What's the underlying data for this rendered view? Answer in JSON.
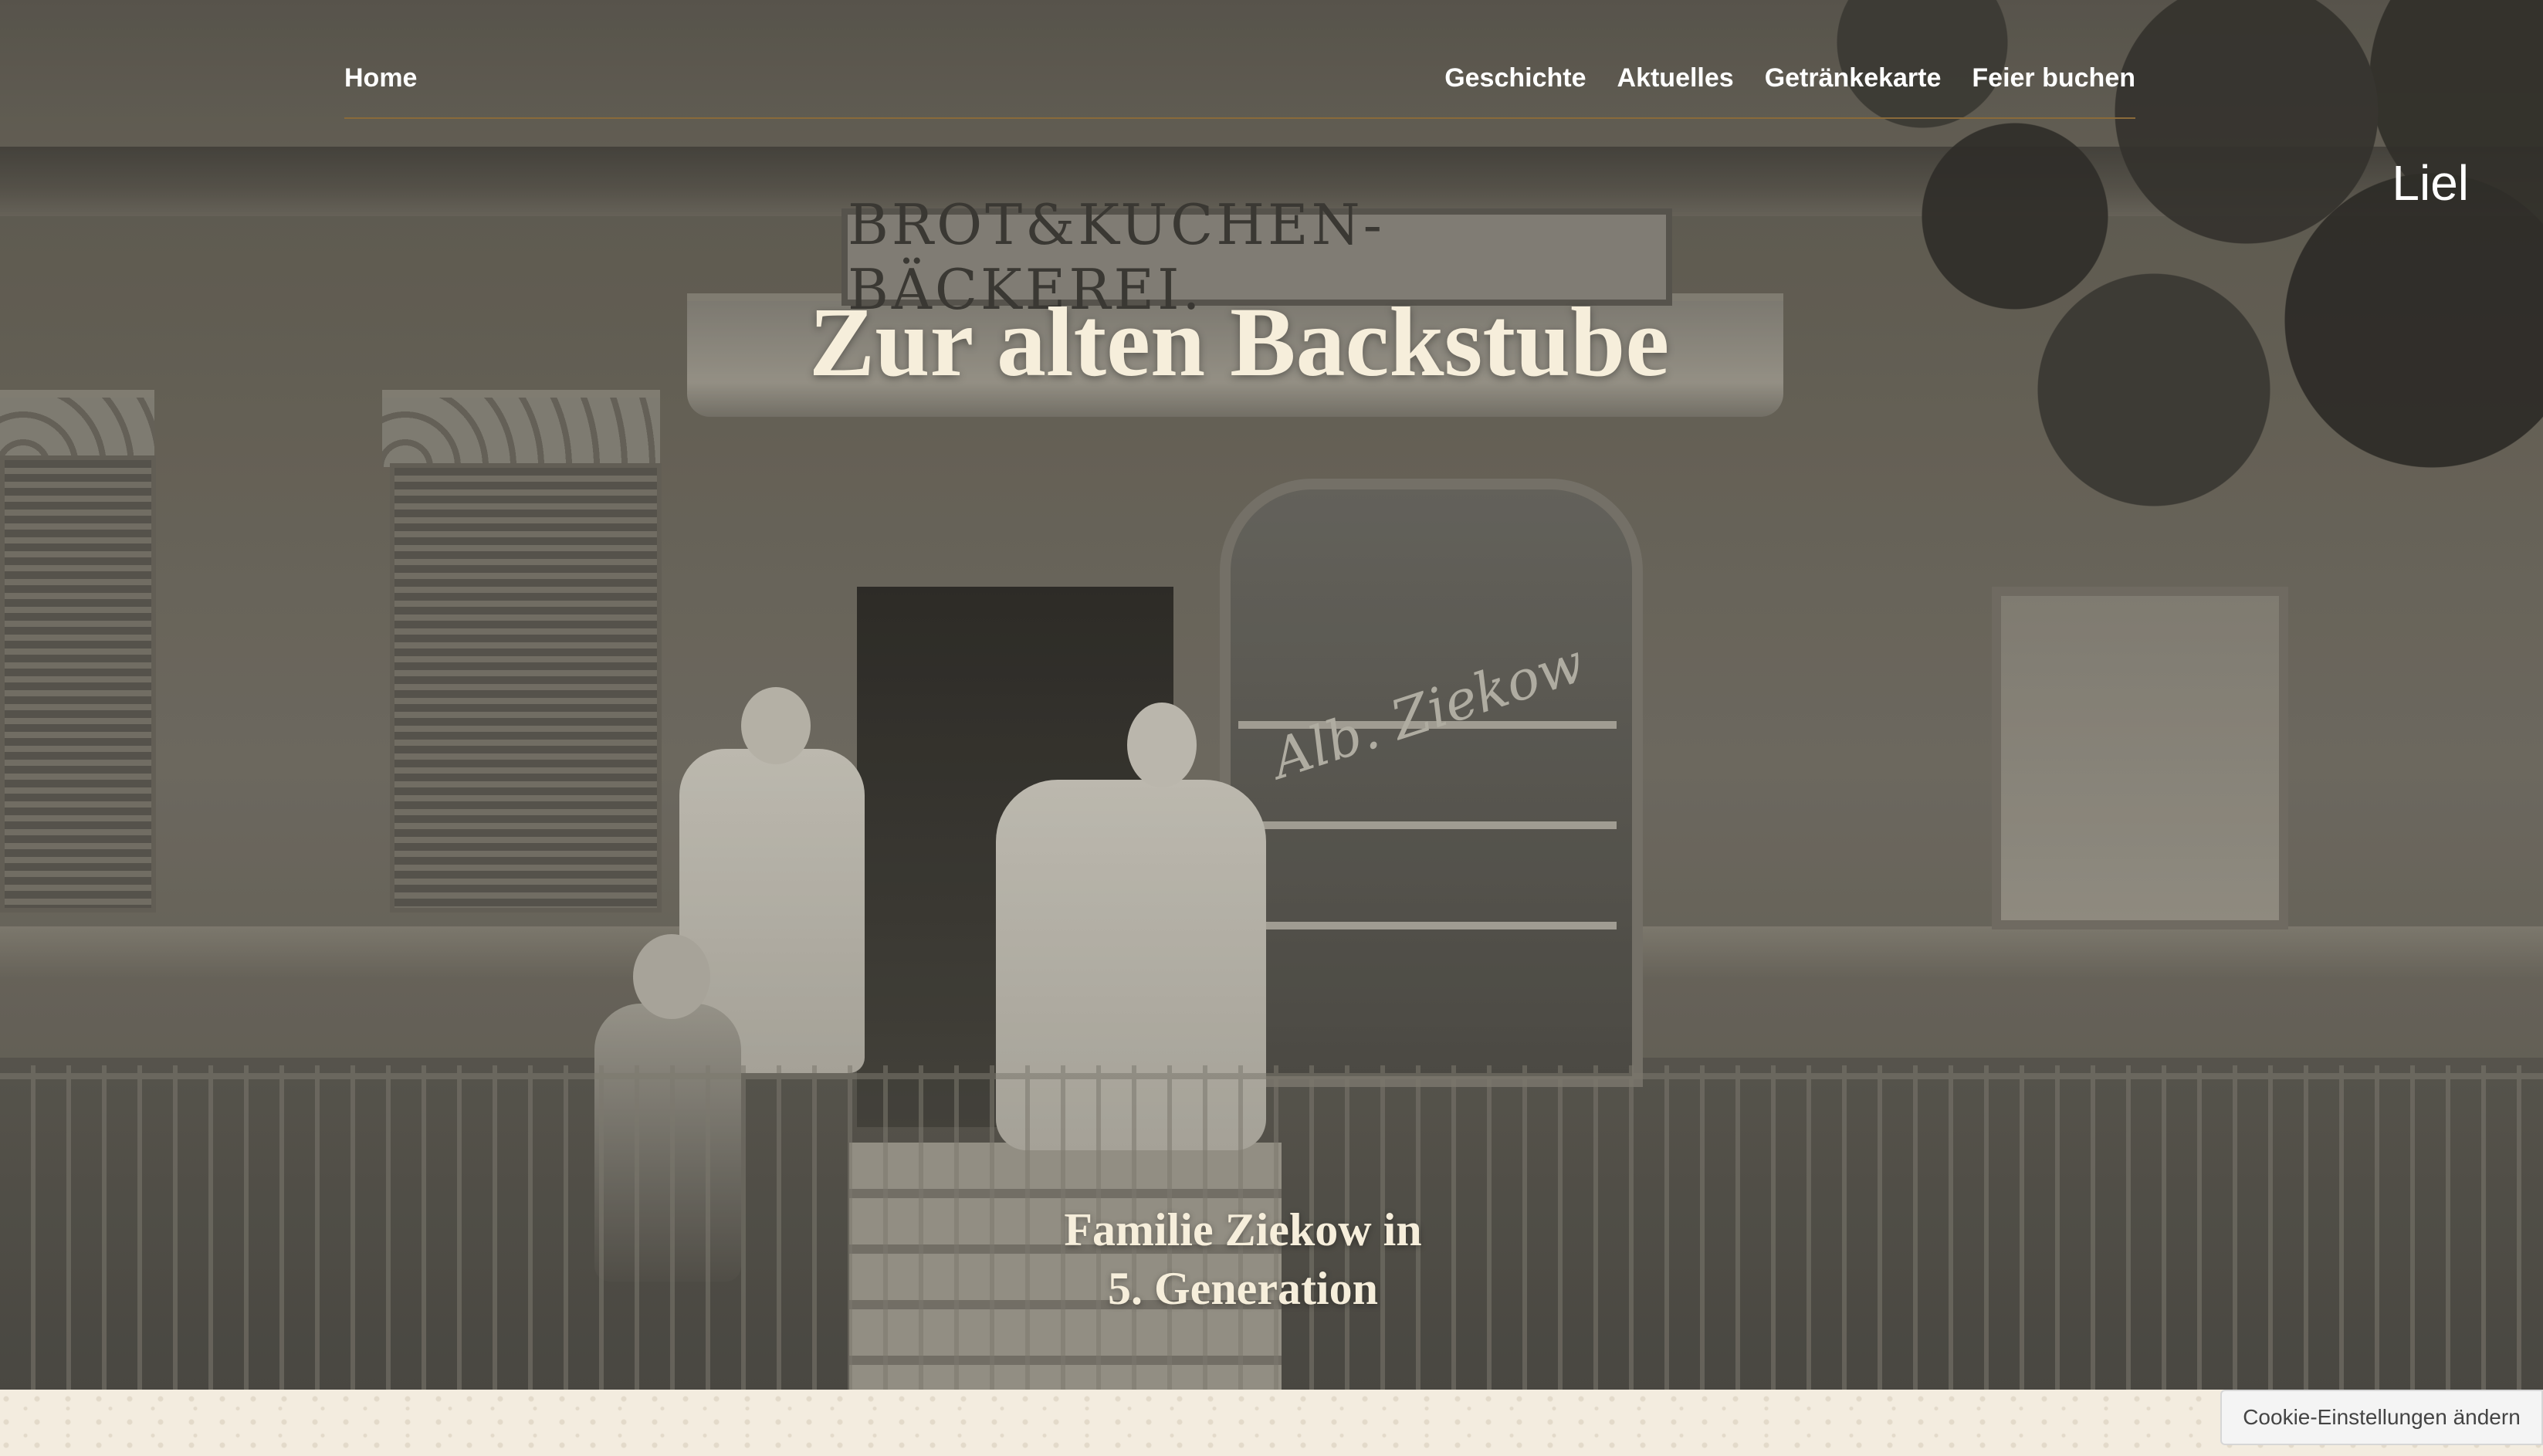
{
  "nav": {
    "home": "Home",
    "items": [
      "Geschichte",
      "Aktuelles",
      "Getränkekarte",
      "Feier buchen"
    ]
  },
  "hero": {
    "corner_text": "Liel",
    "title": "Zur alten Backstube",
    "subtitle_line1": "Familie Ziekow in",
    "subtitle_line2": "5. Generation",
    "photo_sign": "BROT&KUCHEN-BÄCKEREI.",
    "photo_script_sign": "Alb. Ziekow"
  },
  "cookie": {
    "label": "Cookie-Einstellungen ändern"
  },
  "colors": {
    "title_text": "#f6eedb",
    "nav_text": "#ffffff",
    "nav_underline": "#8a6a3a",
    "paper": "#f3ecdf"
  }
}
